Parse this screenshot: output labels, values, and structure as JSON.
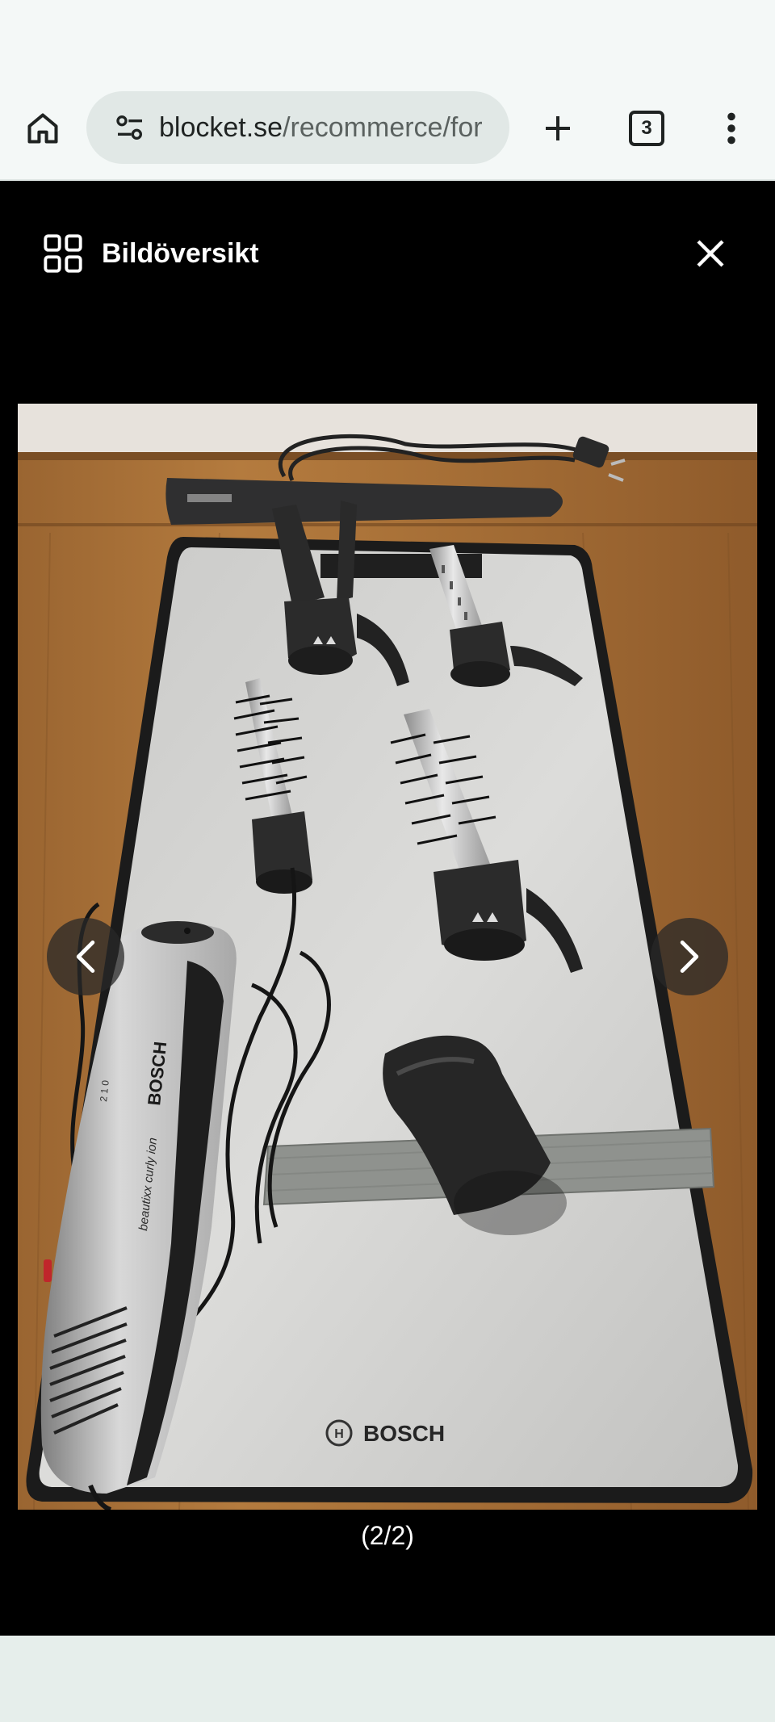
{
  "browser": {
    "url_host": "blocket.se",
    "url_path": "/recommerce/for",
    "tab_count": "3",
    "icons": {
      "home": "home-icon",
      "site_settings": "tune-icon",
      "new_tab": "plus-icon",
      "tabs": "tab-switcher-icon",
      "menu": "more-vert-icon"
    }
  },
  "viewer": {
    "overview_label": "Bildöversikt",
    "counter": "(2/2)",
    "icons": {
      "overview": "grid-icon",
      "close": "close-icon",
      "prev": "chevron-left-icon",
      "next": "chevron-right-icon"
    }
  },
  "photo": {
    "mat_brand": "BOSCH",
    "dryer_brand": "BOSCH",
    "dryer_model": "beautixx curly ion",
    "dryer_switch": "2 1 0"
  }
}
